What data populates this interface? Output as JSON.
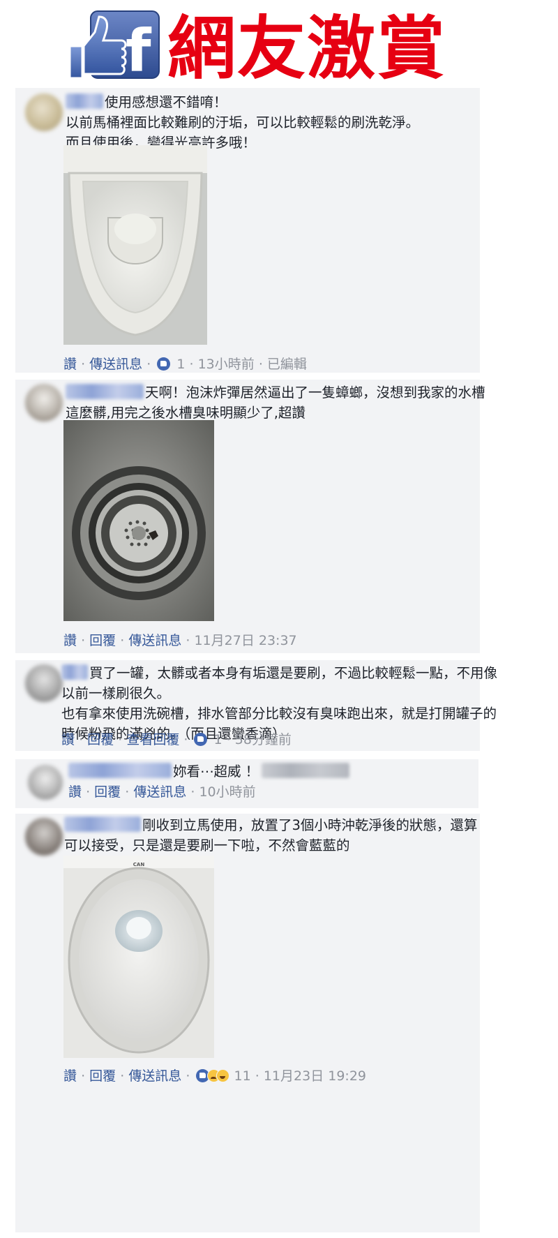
{
  "header": {
    "title": "網友激賞",
    "logo_letter": "f"
  },
  "comments": [
    {
      "lines": [
        "使用感想還不錯唷！",
        "以前馬桶裡面比較難刷的汙垢，可以比較輕鬆的刷洗乾淨。",
        "而且使用後，變得光亮許多哦！"
      ],
      "actions": {
        "a1": "讚",
        "a2": "傳送訊息",
        "likes": "1",
        "time": "13小時前",
        "extra": "已編輯"
      }
    },
    {
      "lines": [
        "天啊！泡沫炸彈居然逼出了一隻蟑螂，沒想到我家的水槽",
        "這麼髒,用完之後水槽臭味明顯少了,超讚"
      ],
      "actions": {
        "a1": "讚",
        "a2": "回覆",
        "a3": "傳送訊息",
        "time": "11月27日 23:37"
      }
    },
    {
      "lines": [
        "買了一罐，太髒或者本身有垢還是要刷，不過比較輕鬆一點，不用像",
        "以前一樣刷很久。",
        "也有拿來使用洗碗槽，排水管部分比較沒有臭味跑出來，就是打開罐子的",
        "時候粉飛的滿兇的。（而且還蠻香滴）"
      ],
      "actions": {
        "a1": "讚",
        "a2": "回覆",
        "a3": "查看回覆",
        "likes": "1",
        "time": "58分鐘前"
      }
    },
    {
      "lines": [
        "妳看⋯超威 ！"
      ],
      "actions": {
        "a1": "讚",
        "a2": "回覆",
        "a3": "傳送訊息",
        "time": "10小時前"
      }
    },
    {
      "lines": [
        "剛收到立馬使用，放置了3個小時沖乾淨後的狀態，還算",
        "可以接受，只是還是要刷一下啦，不然會藍藍的"
      ],
      "actions": {
        "a1": "讚",
        "a2": "回覆",
        "a3": "傳送訊息",
        "likes": "11",
        "time": "11月23日 19:29"
      },
      "photo_brand": "CAN"
    }
  ],
  "colors": {
    "brand_red": "#e60012",
    "fb_blue": "#3b5998",
    "link": "#365899",
    "meta": "#90949c",
    "card_bg": "#f2f3f5"
  }
}
